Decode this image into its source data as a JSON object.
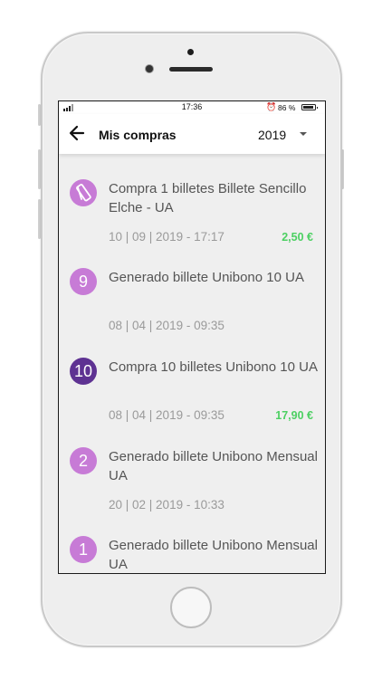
{
  "status": {
    "time": "17:36",
    "battery": "86 %"
  },
  "header": {
    "title": "Mis compras",
    "year": "2019"
  },
  "colors": {
    "badge_light": "#c77bd6",
    "badge_dark": "#5e3292",
    "amount": "#4cd062"
  },
  "items": [
    {
      "badge": "",
      "badge_icon": "ticket-icon",
      "title": "Compra 1 billetes Billete Sencillo Elche - UA",
      "date": "10 | 09 | 2019 - 17:17",
      "amount": "2,50 €"
    },
    {
      "badge": "9",
      "title": "Generado billete Unibono 10 UA",
      "date": "08 | 04 | 2019 - 09:35",
      "amount": ""
    },
    {
      "badge": "10",
      "title": "Compra 10 billetes Unibono 10 UA",
      "date": "08 | 04 | 2019 - 09:35",
      "amount": "17,90 €"
    },
    {
      "badge": "2",
      "title": "Generado billete Unibono Mensual UA",
      "date": "20 | 02 | 2019 - 10:33",
      "amount": ""
    },
    {
      "badge": "1",
      "title": "Generado billete Unibono Mensual UA",
      "date": "",
      "amount": ""
    }
  ]
}
